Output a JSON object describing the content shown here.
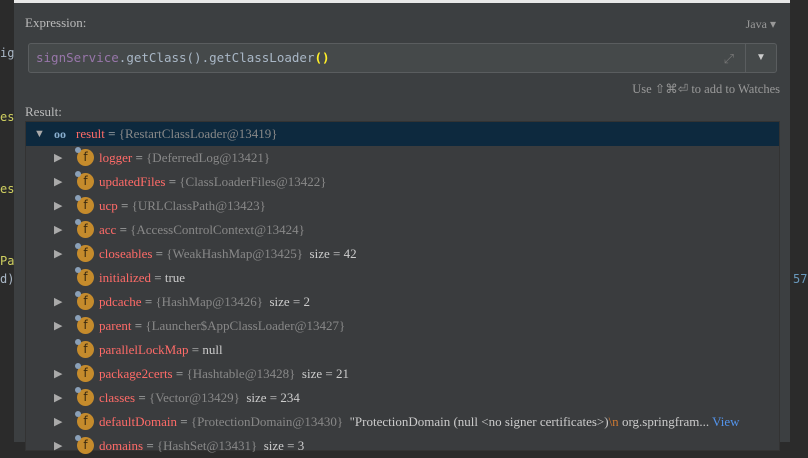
{
  "background_code": {
    "l1": "ig",
    "l2": "es",
    "l3": "es",
    "l4": "Pa",
    "l5": "d)",
    "r1": "57"
  },
  "dialog": {
    "expression_label": "Expression:",
    "language": "Java",
    "expression": {
      "var": "signService",
      "rest": ".getClass().getClassLoader",
      "parens": "()"
    },
    "hint": "Use ⇧⌘⏎ to add to Watches",
    "result_label": "Result:",
    "root": {
      "name": "result",
      "ref": "{RestartClassLoader@13419}"
    },
    "rows": [
      {
        "name": "logger",
        "ref": "{DeferredLog@13421}",
        "extra": "",
        "expandable": true
      },
      {
        "name": "updatedFiles",
        "ref": "{ClassLoaderFiles@13422}",
        "extra": "",
        "expandable": true
      },
      {
        "name": "ucp",
        "ref": "{URLClassPath@13423}",
        "extra": "",
        "expandable": true
      },
      {
        "name": "acc",
        "ref": "{AccessControlContext@13424}",
        "extra": "",
        "expandable": true
      },
      {
        "name": "closeables",
        "ref": "{WeakHashMap@13425}",
        "extra": "size = 42",
        "expandable": true
      },
      {
        "name": "initialized",
        "ref": "",
        "extra": "true",
        "expandable": false
      },
      {
        "name": "pdcache",
        "ref": "{HashMap@13426}",
        "extra": "size = 2",
        "expandable": true
      },
      {
        "name": "parent",
        "ref": "{Launcher$AppClassLoader@13427}",
        "extra": "",
        "expandable": true
      },
      {
        "name": "parallelLockMap",
        "ref": "",
        "extra": "null",
        "expandable": false
      },
      {
        "name": "package2certs",
        "ref": "{Hashtable@13428}",
        "extra": "size = 21",
        "expandable": true
      },
      {
        "name": "classes",
        "ref": "{Vector@13429}",
        "extra": "size = 234",
        "expandable": true
      },
      {
        "name": "defaultDomain",
        "ref": "{ProtectionDomain@13430}",
        "extra": "\"ProtectionDomain  (null <no signer certificates>)",
        "esc": "\\n",
        "tail": " org.springfram...",
        "link": "View",
        "expandable": true
      },
      {
        "name": "domains",
        "ref": "{HashSet@13431}",
        "extra": "size = 3",
        "expandable": true
      }
    ]
  }
}
